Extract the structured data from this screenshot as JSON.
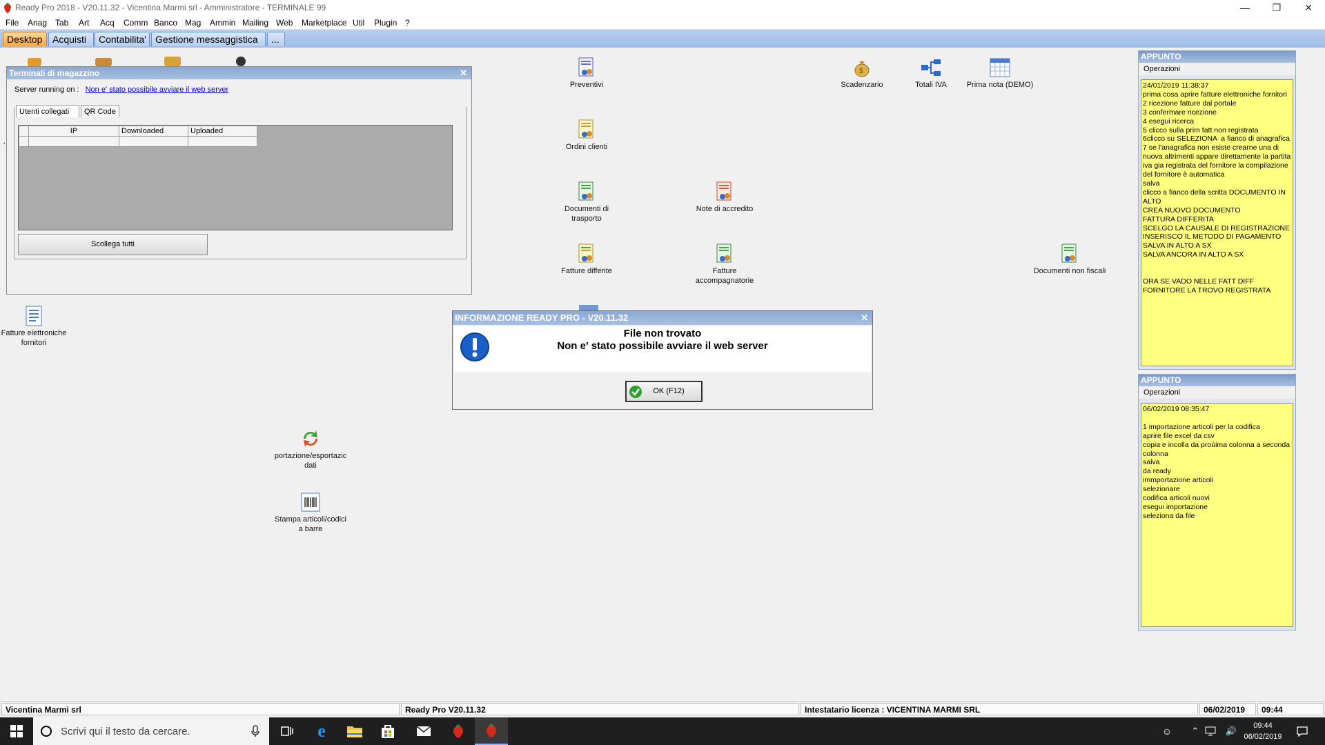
{
  "window": {
    "title": "Ready Pro 2018 - V20.11.32 - Vicentina Marmi srl - Amministratore - TERMINALE 99"
  },
  "menu": [
    "File",
    "Anag",
    "Tab",
    "Art",
    "Acq",
    "Comm",
    "Banco",
    "Mag",
    "Ammin",
    "Mailing",
    "Web",
    "Marketplace",
    "Util",
    "Plugin",
    "?"
  ],
  "tabs": [
    "Desktop",
    "Acquisti",
    "Contabilita'",
    "Gestione messaggistica",
    "..."
  ],
  "desktop_icons": {
    "preventivi": "Preventivi",
    "ordini_clienti": "Ordini clienti",
    "documenti_trasporto": "Documenti di trasporto",
    "note_accredito": "Note di accredito",
    "fatture_differite": "Fatture differite",
    "fatture_accompagnatorie": "Fatture accompagnatorie",
    "scadenzario": "Scadenzario",
    "totali_iva": "Totali IVA",
    "prima_nota": "Prima nota (DEMO)",
    "documenti_non_fiscali": "Documenti non fiscali",
    "fatture_elettroniche": "Fatture elettroniche fornitori",
    "importazione": "portazione/esportazic dati",
    "stampa_articoli": "Stampa articoli/codici a barre"
  },
  "terminal_window": {
    "title": "Terminali di magazzino",
    "server_label": "Server running on :",
    "server_link": "Non e' stato possibile avviare il web server",
    "tabs": [
      "Utenti collegati",
      "QR Code"
    ],
    "columns": [
      "",
      "IP",
      "Downloaded",
      "Uploaded"
    ],
    "disconnect_button": "Scollega tutti"
  },
  "dialog": {
    "title": "INFORMAZIONE READY PRO - V20.11.32",
    "heading": "File non trovato",
    "message": "Non e' stato possibile avviare il web server",
    "ok_button": "OK (F12)"
  },
  "notes": [
    {
      "title": "APPUNTO",
      "menu": "Operazioni",
      "text": "24/01/2019 11:38:37\nprima cosa aprire fatture elettroniche fornitori\n2 ricezione fatture dal portale\n3 confermare ricezione\n4 esegui ricerca\n5 clicco sulla prim fatt non registrata\n6clicco su SELEZIONA  a fianco di anagrafica\n7 se l'anagrafica non esiste crearne una di nuova altrimenti appare direttamente la partita iva gia registrata del fornitore la compilazione del fornitore è automatica\nsalva\nclicco a fianco della scritta DOCUMENTO IN ALTO\nCREA NUOVO DOCUMENTO\nFATTURA DIFFERITA\nSCELGO LA CAUSALE DI REGISTRAZIONE\nINSERISCO IL METODO DI PAGAMENTO\nSALVA IN ALTO A SX\nSALVA ANCORA IN ALTO A SX\n\n\nORA SE VADO NELLE FATT DIFF\nFORNITORE LA TROVO REGISTRATA"
    },
    {
      "title": "APPUNTO",
      "menu": "Operazioni",
      "text": "06/02/2019 08:35:47\n\n1 importazione articoli per la codifica\naprire file excel da csv\ncopia e incolla da proùima colonna a seconda colonna\nsalva\nda ready\nimmportazione articoli\nselezionare\ncodifica articoli nuovi\nesegui importazione\nseleziona da file"
    }
  ],
  "statusbar": {
    "company": "Vicentina Marmi srl",
    "version": "Ready Pro V20.11.32",
    "license": "Intestatario licenza : VICENTINA MARMI SRL",
    "date": "06/02/2019",
    "time": "09:44"
  },
  "taskbar": {
    "search_placeholder": "Scrivi qui il testo da cercare.",
    "clock_time": "09:44",
    "clock_date": "06/02/2019"
  }
}
